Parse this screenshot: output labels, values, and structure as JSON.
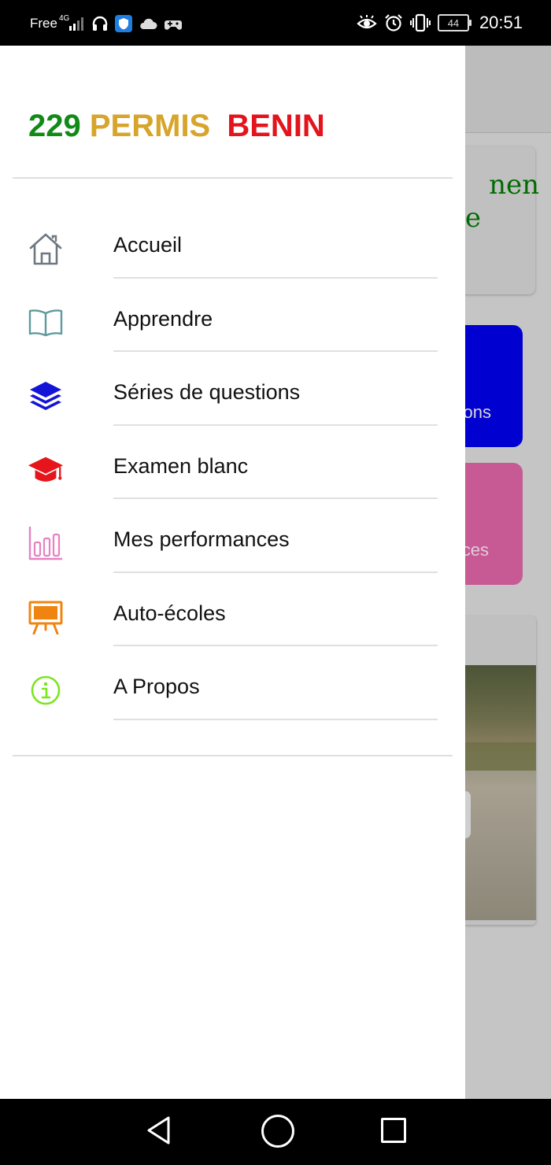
{
  "status_bar": {
    "carrier": "Free",
    "network": "4G",
    "time": "20:51",
    "battery": "44"
  },
  "background": {
    "card1_text": "nen\ne",
    "card2_text": "ons",
    "card3_text": "ces",
    "colors": {
      "card2": "#0000d0",
      "card3": "#c75a95",
      "card1_text": "#006b00"
    }
  },
  "drawer": {
    "brand": {
      "part1": "229",
      "part2": "PERMIS",
      "part3": "BENIN",
      "colors": {
        "part1": "#118a17",
        "part2": "#d7a52c",
        "part3": "#e3141c"
      }
    },
    "menu": [
      {
        "label": "Accueil",
        "icon": "home-icon"
      },
      {
        "label": "Apprendre",
        "icon": "book-icon"
      },
      {
        "label": "Séries de questions",
        "icon": "layers-icon"
      },
      {
        "label": "Examen blanc",
        "icon": "graduation-cap-icon"
      },
      {
        "label": "Mes performances",
        "icon": "bar-chart-icon"
      },
      {
        "label": "Auto-écoles",
        "icon": "easel-icon"
      },
      {
        "label": "A Propos",
        "icon": "info-icon"
      }
    ]
  },
  "nav_bar": {
    "buttons": [
      "back",
      "home",
      "recent-apps"
    ]
  }
}
